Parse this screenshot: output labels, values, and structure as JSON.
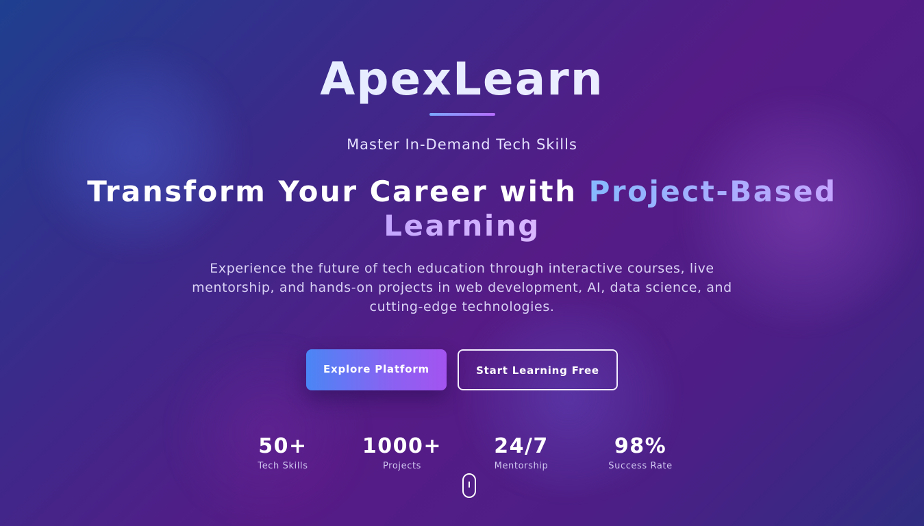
{
  "brand": {
    "name": "ApexLearn"
  },
  "hero": {
    "tagline": "Master In-Demand Tech Skills",
    "headline_prefix": "Transform Your Career with ",
    "headline_highlight": "Project-Based Learning",
    "description": "Experience the future of tech education through interactive courses, live mentorship, and hands-on projects in web development, AI, data science, and cutting-edge technologies."
  },
  "buttons": {
    "primary_label": "Explore Platform",
    "secondary_label": "Start Learning Free"
  },
  "stats": [
    {
      "value": "50+",
      "label": "Tech Skills"
    },
    {
      "value": "1000+",
      "label": "Projects"
    },
    {
      "value": "24/7",
      "label": "Mentorship"
    },
    {
      "value": "98%",
      "label": "Success Rate"
    }
  ],
  "icons": {
    "scroll_indicator": "mouse-scroll-icon"
  },
  "colors": {
    "background_start": "#1f3f8f",
    "background_mid": "#561b86",
    "accent_blue": "#4a86f5",
    "accent_purple": "#a354f0",
    "highlight_text_start": "#86b9ff",
    "highlight_text_end": "#d9b8ff"
  }
}
